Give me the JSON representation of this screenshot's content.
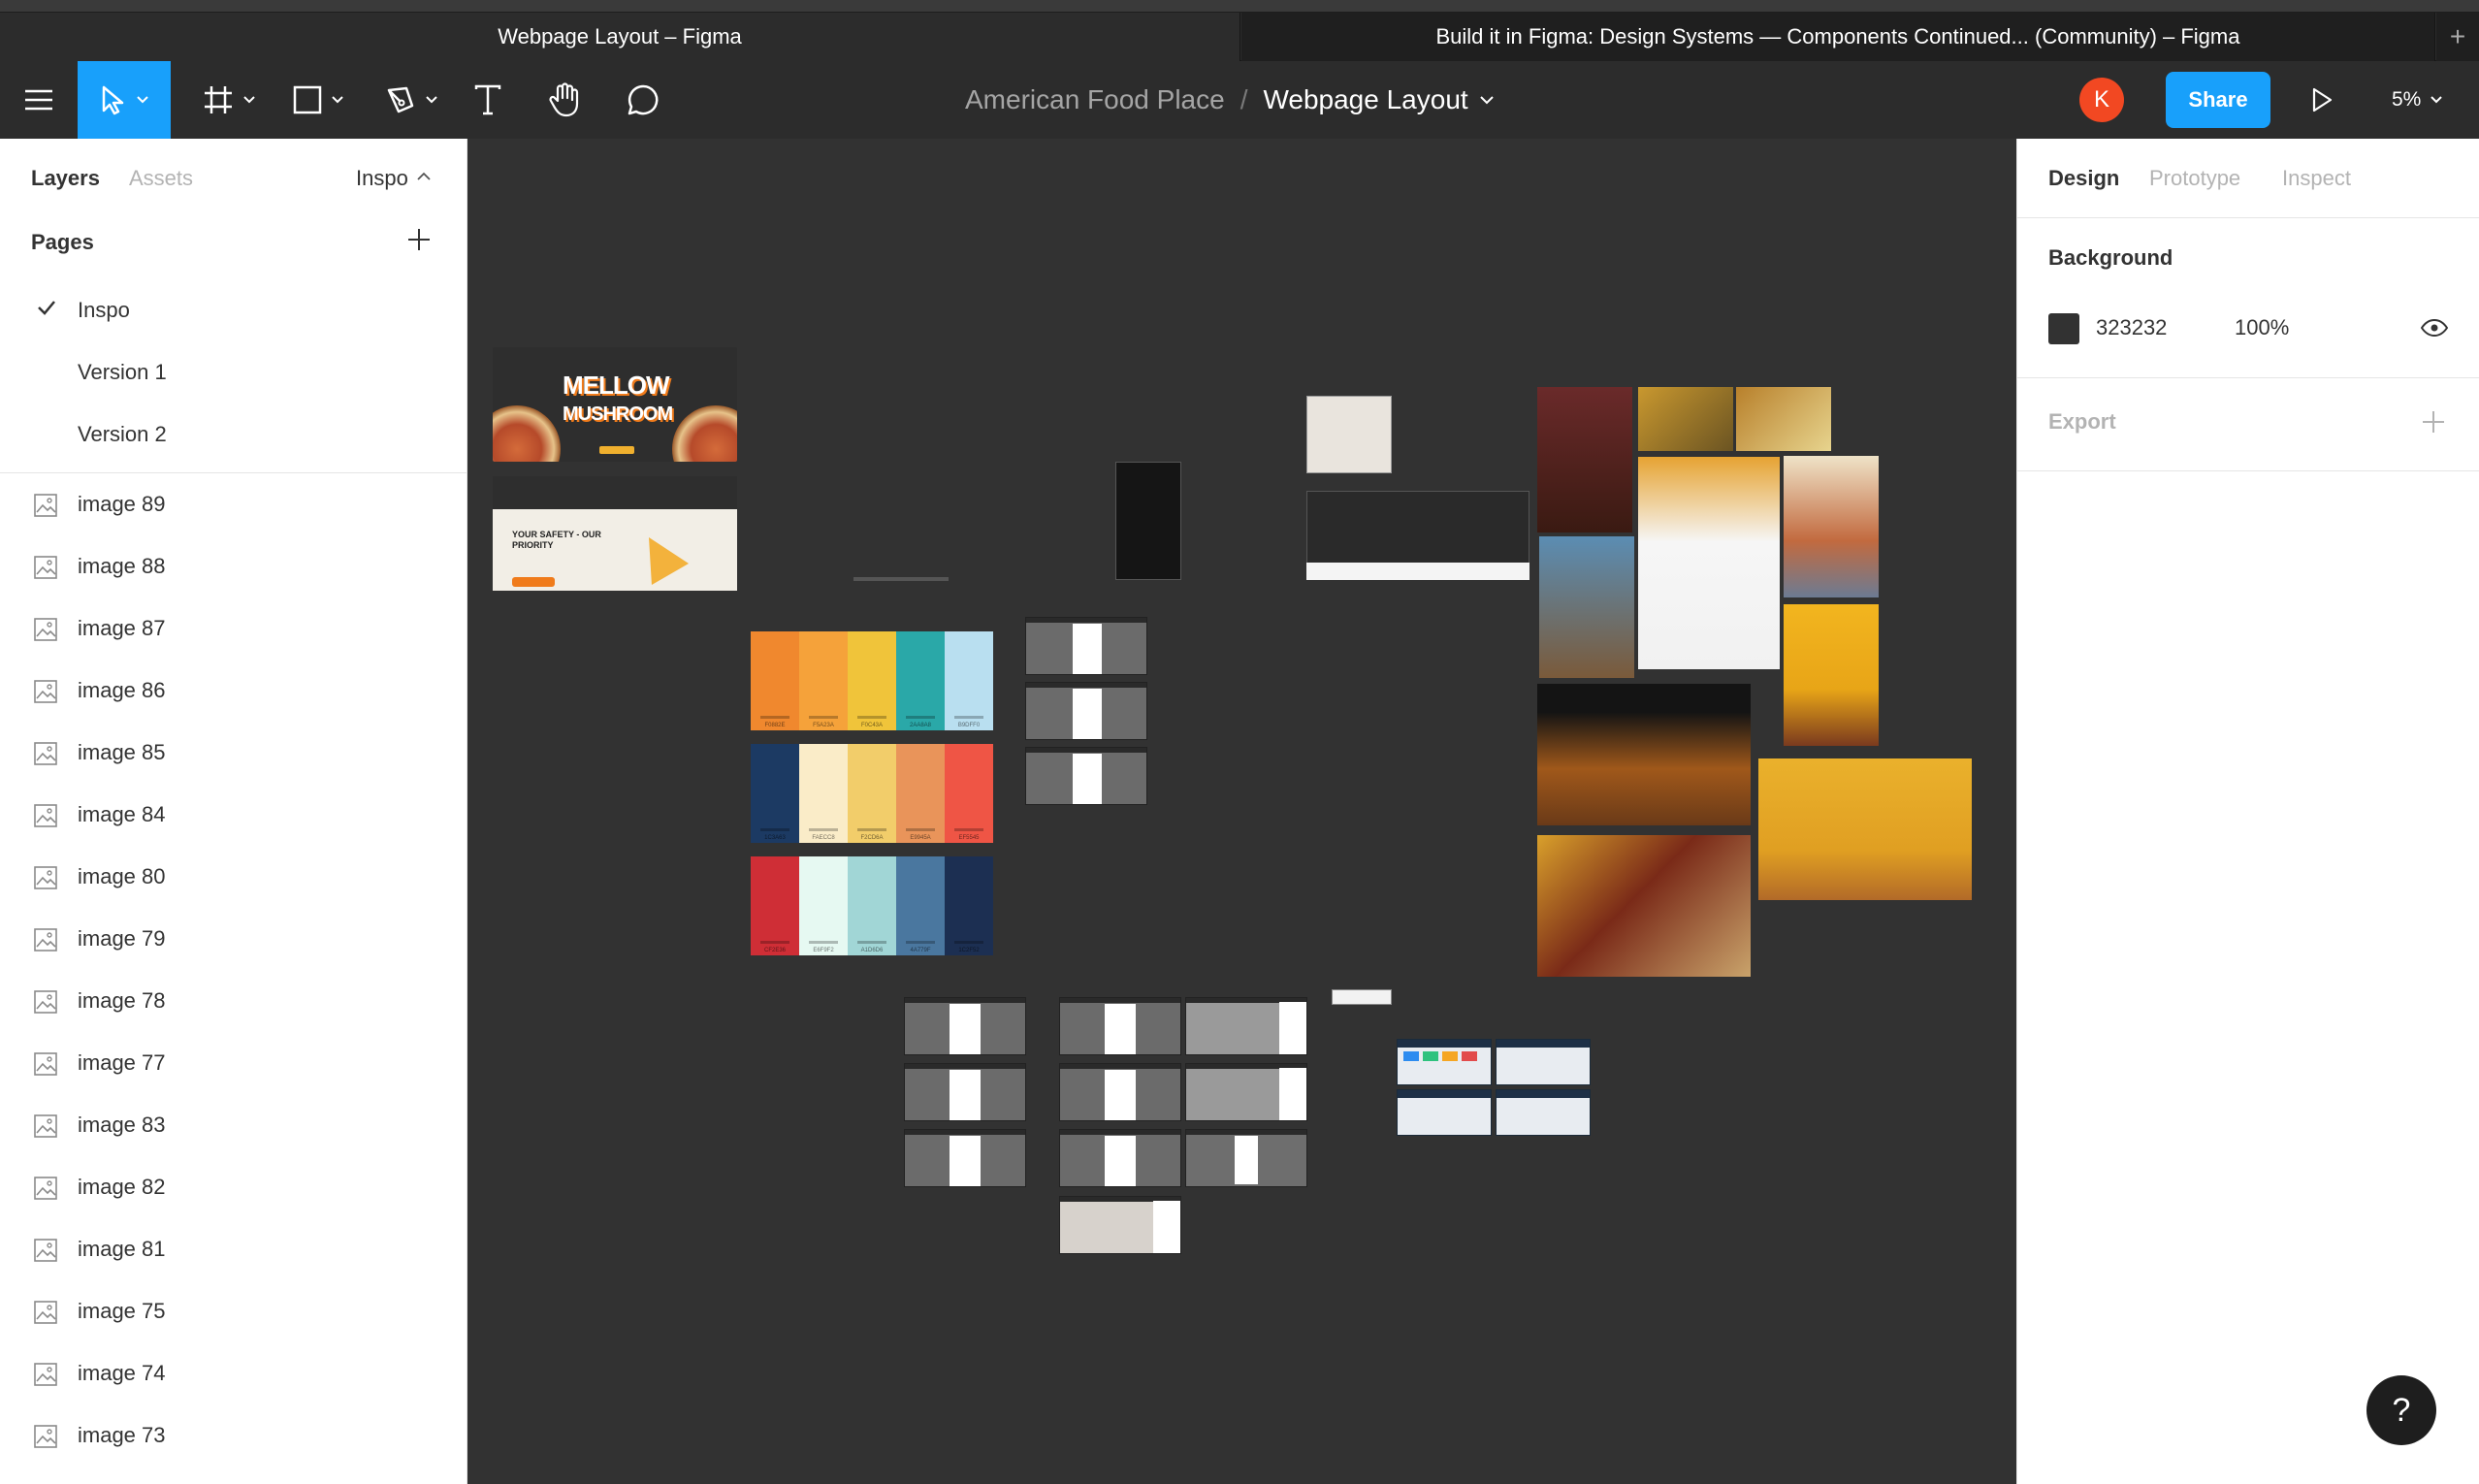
{
  "tabs": [
    {
      "label": "Webpage Layout – Figma",
      "active": true
    },
    {
      "label": "Build it in Figma: Design Systems — Components Continued... (Community) – Figma",
      "active": false
    }
  ],
  "toolbar": {
    "project": "American Food Place",
    "separator": "/",
    "file": "Webpage Layout",
    "avatar_initial": "K",
    "share_label": "Share",
    "zoom": "5%",
    "accent": "#18a0fb",
    "avatar_color": "#f24822"
  },
  "left_panel": {
    "tabs": {
      "layers": "Layers",
      "assets": "Assets",
      "page": "Inspo"
    },
    "pages_title": "Pages",
    "pages": [
      {
        "label": "Inspo",
        "selected": true
      },
      {
        "label": "Version 1",
        "selected": false
      },
      {
        "label": "Version 2",
        "selected": false
      }
    ],
    "layers": [
      "image 89",
      "image 88",
      "image 87",
      "image 86",
      "image 85",
      "image 84",
      "image 80",
      "image 79",
      "image 78",
      "image 77",
      "image 83",
      "image 82",
      "image 81",
      "image 75",
      "image 74",
      "image 73"
    ]
  },
  "canvas": {
    "background": "#323232",
    "hero_title_line1": "MELLOW",
    "hero_title_line2": "MUSHROOM",
    "hero2_text": "YOUR SAFETY - OUR PRIORITY",
    "palettes": [
      [
        "#f0882e",
        "#f5a23a",
        "#f0c43a",
        "#2aa8a8",
        "#b9dff0"
      ],
      [
        "#1c3a63",
        "#faecc8",
        "#f2cd6a",
        "#e9945a",
        "#ef5545"
      ],
      [
        "#cf2e36",
        "#e6f9f2",
        "#a1d6d6",
        "#4a779f",
        "#1c2f52"
      ]
    ],
    "palette_labels": [
      [
        "F0882E",
        "F5A23A",
        "F0C43A",
        "2AA8A8",
        "B9DFF0"
      ],
      [
        "1C3A63",
        "FAECC8",
        "F2CD6A",
        "E9945A",
        "EF5545"
      ],
      [
        "CF2E36",
        "E6F9F2",
        "A1D6D6",
        "4A779F",
        "1C2F52"
      ]
    ]
  },
  "right_panel": {
    "tabs": {
      "design": "Design",
      "prototype": "Prototype",
      "inspect": "Inspect"
    },
    "background_title": "Background",
    "background_hex": "323232",
    "background_opacity": "100%",
    "export_title": "Export"
  },
  "help_label": "?"
}
